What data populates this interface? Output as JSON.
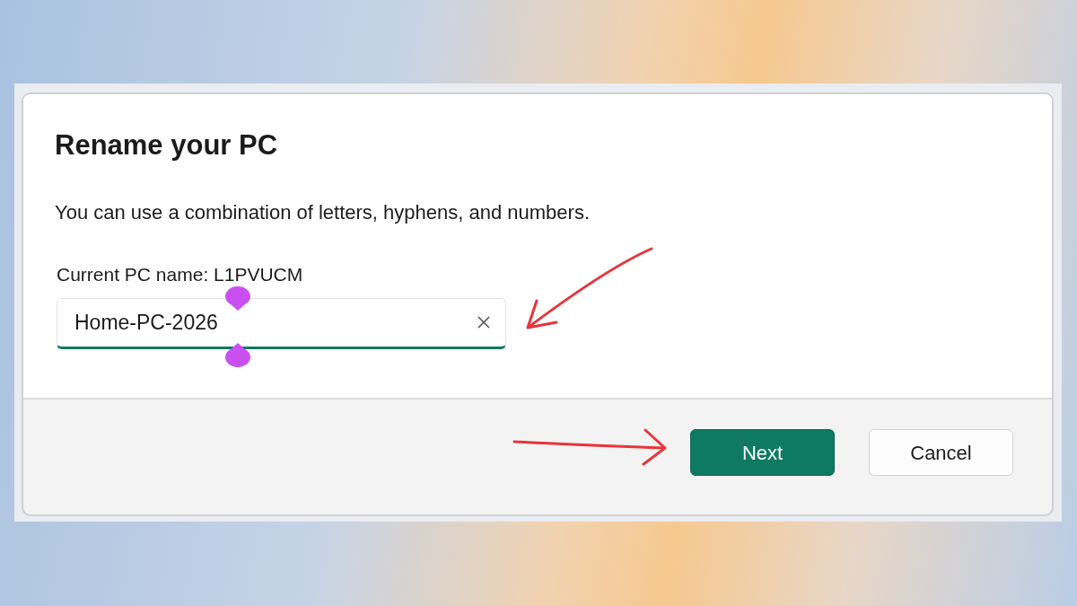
{
  "dialog": {
    "title": "Rename your PC",
    "description": "You can use a combination of letters, hyphens, and numbers.",
    "current_name": "Current PC name: L1PVUCM",
    "name_field": {
      "value": "Home-PC-2026",
      "focused": true
    },
    "buttons": [
      {
        "label": "Next",
        "kind": "primary"
      },
      {
        "label": "Cancel",
        "kind": "secondary"
      }
    ]
  }
}
